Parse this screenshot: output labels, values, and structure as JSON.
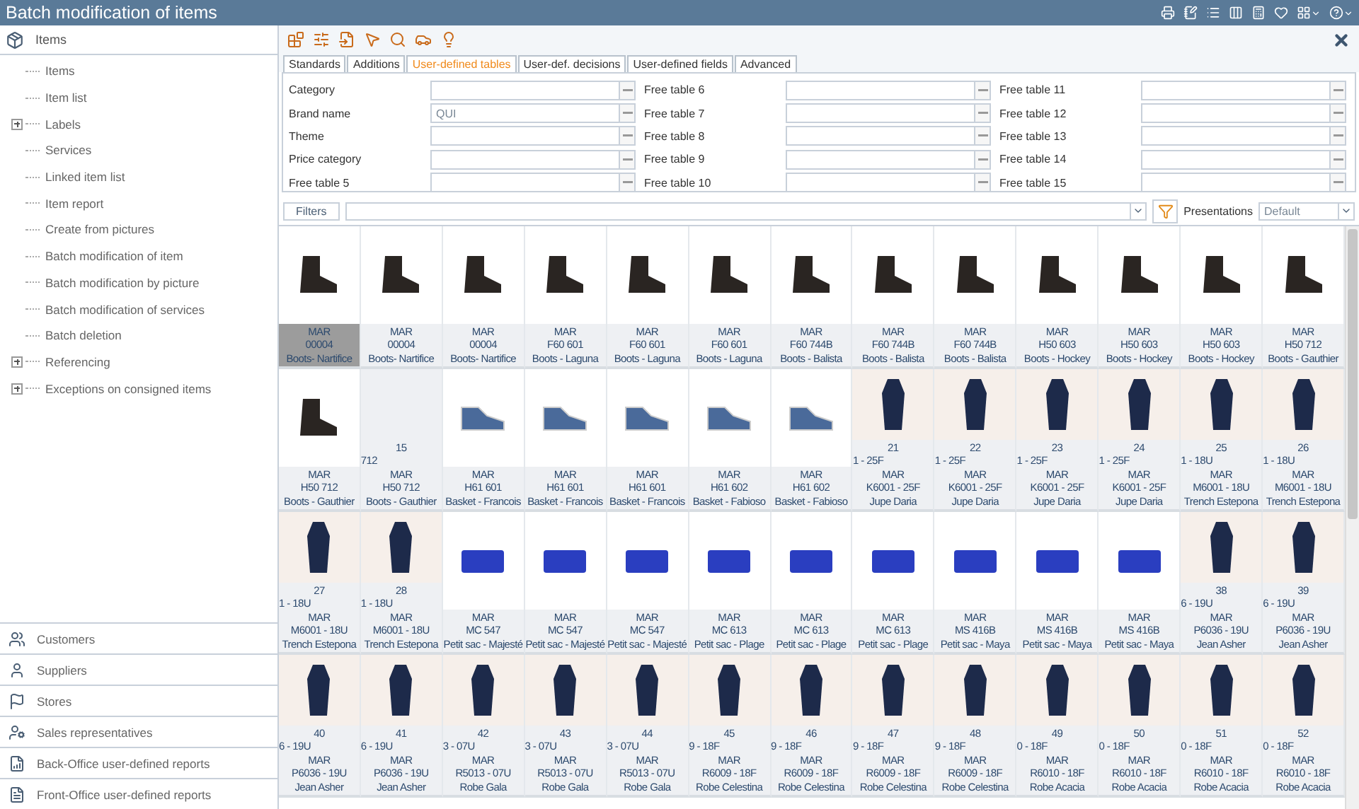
{
  "window": {
    "title": "Batch modification of items"
  },
  "sidebar": {
    "header": "Items",
    "items": [
      {
        "label": "Items",
        "expandable": false
      },
      {
        "label": "Item list",
        "expandable": false
      },
      {
        "label": "Labels",
        "expandable": true
      },
      {
        "label": "Services",
        "expandable": false
      },
      {
        "label": "Linked item list",
        "expandable": false
      },
      {
        "label": "Item report",
        "expandable": false
      },
      {
        "label": "Create from pictures",
        "expandable": false
      },
      {
        "label": "Batch modification of item",
        "expandable": false
      },
      {
        "label": "Batch modification by picture",
        "expandable": false
      },
      {
        "label": "Batch modification of services",
        "expandable": false
      },
      {
        "label": "Batch deletion",
        "expandable": false
      },
      {
        "label": "Referencing",
        "expandable": true
      },
      {
        "label": "Exceptions on consigned items",
        "expandable": true
      }
    ],
    "sections": [
      {
        "label": "Customers"
      },
      {
        "label": "Suppliers"
      },
      {
        "label": "Stores"
      },
      {
        "label": "Sales representatives"
      },
      {
        "label": "Back-Office user-defined reports"
      },
      {
        "label": "Front-Office user-defined reports"
      }
    ]
  },
  "tabs": [
    {
      "label": "Standards",
      "selected": false
    },
    {
      "label": "Additions",
      "selected": false
    },
    {
      "label": "User-defined tables",
      "selected": true
    },
    {
      "label": "User-def. decisions",
      "selected": false
    },
    {
      "label": "User-defined fields",
      "selected": false
    },
    {
      "label": "Advanced",
      "selected": false
    }
  ],
  "form": {
    "columns": [
      [
        {
          "label": "Category"
        },
        {
          "label": "Brand name",
          "value": "QUI"
        },
        {
          "label": "Theme"
        },
        {
          "label": "Price category"
        },
        {
          "label": "Free table 5"
        }
      ],
      [
        {
          "label": "Free table 6"
        },
        {
          "label": "Free table 7"
        },
        {
          "label": "Free table 8"
        },
        {
          "label": "Free table 9"
        },
        {
          "label": "Free table 10"
        }
      ],
      [
        {
          "label": "Free table 11"
        },
        {
          "label": "Free table 12"
        },
        {
          "label": "Free table 13"
        },
        {
          "label": "Free table 14"
        },
        {
          "label": "Free table 15"
        }
      ]
    ]
  },
  "filter_bar": {
    "button": "Filters",
    "presentations_label": "Presentations",
    "presentation": "Default"
  },
  "grid": {
    "rows": [
      [
        {
          "kind": "boot",
          "brand": "MAR",
          "code": "00004",
          "name": "Boots- Nartifice",
          "selected": true
        },
        {
          "kind": "boot",
          "brand": "MAR",
          "code": "00004",
          "name": "Boots- Nartifice",
          "selected": false
        },
        {
          "kind": "boot",
          "brand": "MAR",
          "code": "00004",
          "name": "Boots- Nartifice",
          "selected": false
        },
        {
          "kind": "boot",
          "brand": "MAR",
          "code": "F60 601",
          "name": "Boots - Laguna",
          "selected": false
        },
        {
          "kind": "boot",
          "brand": "MAR",
          "code": "F60 601",
          "name": "Boots - Laguna",
          "selected": false
        },
        {
          "kind": "boot",
          "brand": "MAR",
          "code": "F60 601",
          "name": "Boots - Laguna",
          "selected": false
        },
        {
          "kind": "boot",
          "brand": "MAR",
          "code": "F60 744B",
          "name": "Boots - Balista",
          "selected": false
        },
        {
          "kind": "boot",
          "brand": "MAR",
          "code": "F60 744B",
          "name": "Boots - Balista",
          "selected": false
        },
        {
          "kind": "boot",
          "brand": "MAR",
          "code": "F60 744B",
          "name": "Boots - Balista",
          "selected": false
        },
        {
          "kind": "boot",
          "brand": "MAR",
          "code": "H50 603",
          "name": "Boots - Hockey",
          "selected": false
        },
        {
          "kind": "boot",
          "brand": "MAR",
          "code": "H50 603",
          "name": "Boots - Hockey",
          "selected": false
        },
        {
          "kind": "boot",
          "brand": "MAR",
          "code": "H50 603",
          "name": "Boots - Hockey",
          "selected": false
        },
        {
          "kind": "boot",
          "brand": "MAR",
          "code": "H50 712",
          "name": "Boots - Gauthier",
          "selected": false
        }
      ],
      [
        {
          "kind": "boot",
          "brand": "MAR",
          "code": "H50 712",
          "name": "Boots - Gauthier",
          "selected": false
        },
        {
          "kind": "none",
          "number": "15",
          "prefix": "712",
          "brand": "MAR",
          "code": "H50 712",
          "name": "Boots - Gauthier",
          "selected": false
        },
        {
          "kind": "sneaker",
          "brand": "MAR",
          "code": "H61 601",
          "name": "Basket - Francois",
          "selected": false
        },
        {
          "kind": "sneaker",
          "brand": "MAR",
          "code": "H61 601",
          "name": "Basket - Francois",
          "selected": false
        },
        {
          "kind": "sneaker",
          "brand": "MAR",
          "code": "H61 601",
          "name": "Basket - Francois",
          "selected": false
        },
        {
          "kind": "sneaker",
          "brand": "MAR",
          "code": "H61 602",
          "name": "Basket - Fabioso",
          "selected": false
        },
        {
          "kind": "sneaker",
          "brand": "MAR",
          "code": "H61 602",
          "name": "Basket - Fabioso",
          "selected": false
        },
        {
          "kind": "clothing",
          "number": "21",
          "prefix": "1 - 25F",
          "brand": "MAR",
          "code": "K6001 - 25F",
          "name": "Jupe Daria",
          "selected": false
        },
        {
          "kind": "clothing",
          "number": "22",
          "prefix": "1 - 25F",
          "brand": "MAR",
          "code": "K6001 - 25F",
          "name": "Jupe Daria",
          "selected": false
        },
        {
          "kind": "clothing",
          "number": "23",
          "prefix": "1 - 25F",
          "brand": "MAR",
          "code": "K6001 - 25F",
          "name": "Jupe Daria",
          "selected": false
        },
        {
          "kind": "clothing",
          "number": "24",
          "prefix": "1 - 25F",
          "brand": "MAR",
          "code": "K6001 - 25F",
          "name": "Jupe Daria",
          "selected": false
        },
        {
          "kind": "clothing",
          "number": "25",
          "prefix": "1 - 18U",
          "brand": "MAR",
          "code": "M6001 - 18U",
          "name": "Trench Estepona",
          "selected": false
        },
        {
          "kind": "clothing",
          "number": "26",
          "prefix": "1 - 18U",
          "brand": "MAR",
          "code": "M6001 - 18U",
          "name": "Trench Estepona",
          "selected": false
        }
      ],
      [
        {
          "kind": "clothing",
          "number": "27",
          "prefix": "1 - 18U",
          "brand": "MAR",
          "code": "M6001 - 18U",
          "name": "Trench Estepona",
          "selected": false
        },
        {
          "kind": "clothing",
          "number": "28",
          "prefix": "1 - 18U",
          "brand": "MAR",
          "code": "M6001 - 18U",
          "name": "Trench Estepona",
          "selected": false
        },
        {
          "kind": "bag",
          "brand": "MAR",
          "code": "MC 547",
          "name": "Petit sac - Majesté",
          "selected": false
        },
        {
          "kind": "bag",
          "brand": "MAR",
          "code": "MC 547",
          "name": "Petit sac - Majesté",
          "selected": false
        },
        {
          "kind": "bag",
          "brand": "MAR",
          "code": "MC 547",
          "name": "Petit sac - Majesté",
          "selected": false
        },
        {
          "kind": "bag",
          "brand": "MAR",
          "code": "MC 613",
          "name": "Petit sac - Plage",
          "selected": false
        },
        {
          "kind": "bag",
          "brand": "MAR",
          "code": "MC 613",
          "name": "Petit sac - Plage",
          "selected": false
        },
        {
          "kind": "bag",
          "brand": "MAR",
          "code": "MC 613",
          "name": "Petit sac - Plage",
          "selected": false
        },
        {
          "kind": "bag",
          "brand": "MAR",
          "code": "MS 416B",
          "name": "Petit sac - Maya",
          "selected": false
        },
        {
          "kind": "bag",
          "brand": "MAR",
          "code": "MS 416B",
          "name": "Petit sac - Maya",
          "selected": false
        },
        {
          "kind": "bag",
          "brand": "MAR",
          "code": "MS 416B",
          "name": "Petit sac - Maya",
          "selected": false
        },
        {
          "kind": "clothing",
          "number": "38",
          "prefix": "6 - 19U",
          "brand": "MAR",
          "code": "P6036 - 19U",
          "name": "Jean Asher",
          "selected": false
        },
        {
          "kind": "clothing",
          "number": "39",
          "prefix": "6 - 19U",
          "brand": "MAR",
          "code": "P6036 - 19U",
          "name": "Jean Asher",
          "selected": false
        }
      ],
      [
        {
          "kind": "clothing",
          "number": "40",
          "prefix": "6 - 19U",
          "brand": "MAR",
          "code": "P6036 - 19U",
          "name": "Jean Asher",
          "selected": false
        },
        {
          "kind": "clothing",
          "number": "41",
          "prefix": "6 - 19U",
          "brand": "MAR",
          "code": "P6036 - 19U",
          "name": "Jean Asher",
          "selected": false
        },
        {
          "kind": "clothing",
          "number": "42",
          "prefix": "3 - 07U",
          "brand": "MAR",
          "code": "R5013 - 07U",
          "name": "Robe Gala",
          "selected": false
        },
        {
          "kind": "clothing",
          "number": "43",
          "prefix": "3 - 07U",
          "brand": "MAR",
          "code": "R5013 - 07U",
          "name": "Robe Gala",
          "selected": false
        },
        {
          "kind": "clothing",
          "number": "44",
          "prefix": "3 - 07U",
          "brand": "MAR",
          "code": "R5013 - 07U",
          "name": "Robe Gala",
          "selected": false
        },
        {
          "kind": "clothing",
          "number": "45",
          "prefix": "9 - 18F",
          "brand": "MAR",
          "code": "R6009 - 18F",
          "name": "Robe Celestina",
          "selected": false
        },
        {
          "kind": "clothing",
          "number": "46",
          "prefix": "9 - 18F",
          "brand": "MAR",
          "code": "R6009 - 18F",
          "name": "Robe Celestina",
          "selected": false
        },
        {
          "kind": "clothing",
          "number": "47",
          "prefix": "9 - 18F",
          "brand": "MAR",
          "code": "R6009 - 18F",
          "name": "Robe Celestina",
          "selected": false
        },
        {
          "kind": "clothing",
          "number": "48",
          "prefix": "9 - 18F",
          "brand": "MAR",
          "code": "R6009 - 18F",
          "name": "Robe Celestina",
          "selected": false
        },
        {
          "kind": "clothing",
          "number": "49",
          "prefix": "0 - 18F",
          "brand": "MAR",
          "code": "R6010 - 18F",
          "name": "Robe Acacia",
          "selected": false
        },
        {
          "kind": "clothing",
          "number": "50",
          "prefix": "0 - 18F",
          "brand": "MAR",
          "code": "R6010 - 18F",
          "name": "Robe Acacia",
          "selected": false
        },
        {
          "kind": "clothing",
          "number": "51",
          "prefix": "0 - 18F",
          "brand": "MAR",
          "code": "R6010 - 18F",
          "name": "Robe Acacia",
          "selected": false
        },
        {
          "kind": "clothing",
          "number": "52",
          "prefix": "0 - 18F",
          "brand": "MAR",
          "code": "R6010 - 18F",
          "name": "Robe Acacia",
          "selected": false
        }
      ]
    ]
  }
}
